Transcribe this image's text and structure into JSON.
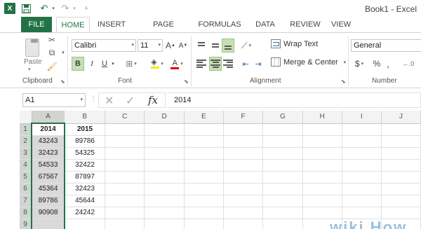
{
  "app": {
    "document_title": "Book1 - Excel",
    "logo_text": "X",
    "accent_color": "#217346"
  },
  "quick_access": {
    "icons": [
      "excel-logo-icon",
      "save-icon",
      "undo-icon",
      "redo-icon",
      "customize-qat-icon"
    ]
  },
  "tabs": [
    {
      "label": "FILE"
    },
    {
      "label": "HOME"
    },
    {
      "label": "INSERT"
    },
    {
      "label": "PAGE LAYOUT"
    },
    {
      "label": "FORMULAS"
    },
    {
      "label": "DATA"
    },
    {
      "label": "REVIEW"
    },
    {
      "label": "VIEW"
    }
  ],
  "ribbon": {
    "clipboard": {
      "label": "Clipboard",
      "paste_label": "Paste"
    },
    "font": {
      "label": "Font",
      "font_name": "Calibri",
      "font_size": "11",
      "grow_label": "A",
      "shrink_label": "A",
      "bold": "B",
      "italic": "I",
      "underline": "U",
      "font_color_label": "A"
    },
    "alignment": {
      "label": "Alignment",
      "wrap_text": "Wrap Text",
      "merge_center": "Merge & Center"
    },
    "number": {
      "label": "Number",
      "format": "General",
      "currency": "$",
      "percent": "%",
      "comma": ","
    }
  },
  "formula_bar": {
    "name_box": "A1",
    "fx_label": "fx",
    "value": "2014"
  },
  "sheet": {
    "columns": [
      "A",
      "B",
      "C",
      "D",
      "E",
      "F",
      "G",
      "H",
      "I",
      "J"
    ],
    "rows": [
      {
        "num": "1",
        "cells": [
          "2014",
          "2015"
        ]
      },
      {
        "num": "2",
        "cells": [
          "43243",
          "89786"
        ]
      },
      {
        "num": "3",
        "cells": [
          "32423",
          "54325"
        ]
      },
      {
        "num": "4",
        "cells": [
          "54533",
          "32422"
        ]
      },
      {
        "num": "5",
        "cells": [
          "67567",
          "87897"
        ]
      },
      {
        "num": "6",
        "cells": [
          "45364",
          "32423"
        ]
      },
      {
        "num": "7",
        "cells": [
          "89786",
          "45644"
        ]
      },
      {
        "num": "8",
        "cells": [
          "90908",
          "24242"
        ]
      },
      {
        "num": "9",
        "cells": [
          "",
          ""
        ]
      }
    ]
  },
  "watermark": "wiki How"
}
